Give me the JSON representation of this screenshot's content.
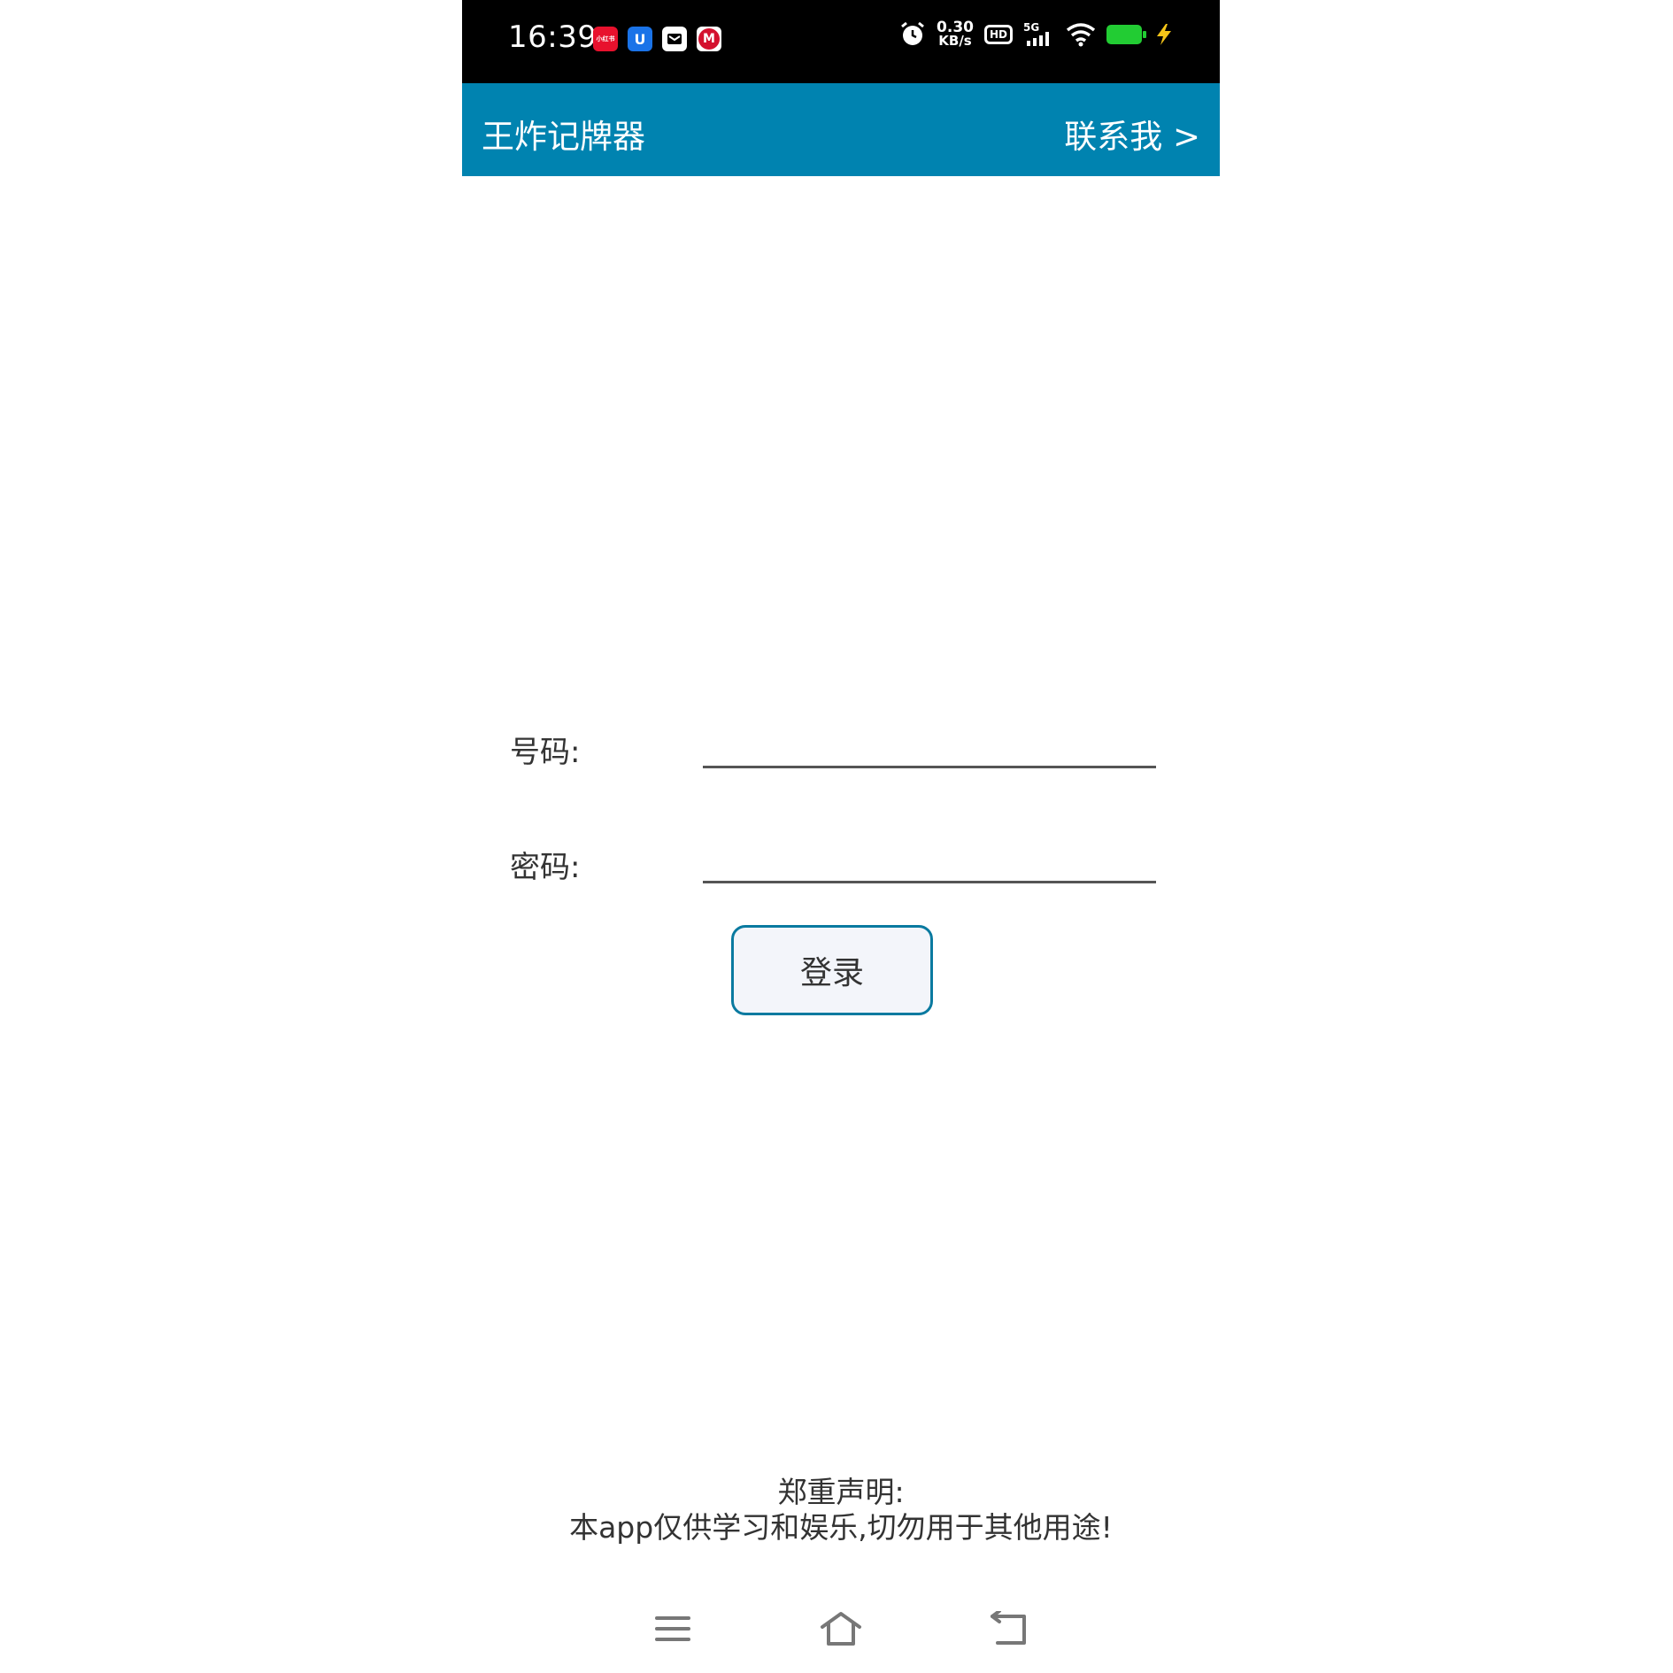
{
  "status_bar": {
    "time": "16:39",
    "notification_icons": [
      {
        "name": "xiaohongshu-icon",
        "label": "小红书",
        "color": "#e8112d"
      },
      {
        "name": "blue-app-icon",
        "label": "U",
        "color": "#1a73e8"
      },
      {
        "name": "message-icon",
        "label": "",
        "color": "#ffffff"
      },
      {
        "name": "bank-app-icon",
        "label": "M",
        "color": "#d4102e"
      }
    ],
    "network_speed_value": "0.30",
    "network_speed_unit": "KB/s",
    "hd_label": "HD",
    "signal_label": "5G",
    "battery_color": "#22cc33",
    "charging_color": "#f5c518"
  },
  "app_bar": {
    "title": "王炸记牌器",
    "contact_label": "联系我 >",
    "background": "#0083b0"
  },
  "login_form": {
    "phone_label": "号码:",
    "phone_value": "",
    "password_label": "密码:",
    "password_value": "",
    "login_button_label": "登录"
  },
  "disclaimer": {
    "heading": "郑重声明:",
    "text": "本app仅供学习和娱乐,切勿用于其他用途!"
  },
  "nav_bar": {
    "buttons": [
      "menu-icon",
      "home-icon",
      "back-icon"
    ]
  }
}
